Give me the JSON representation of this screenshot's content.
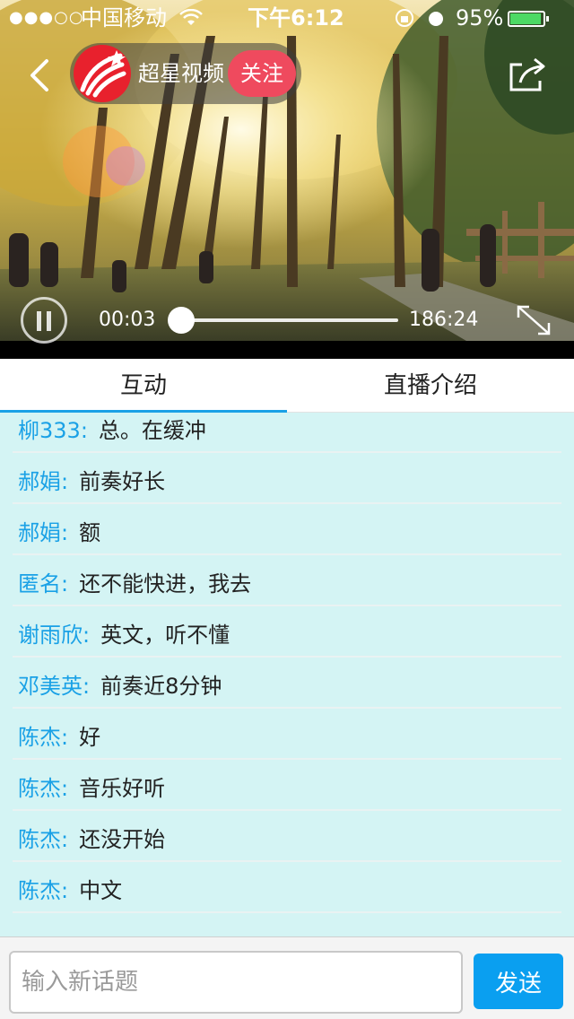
{
  "status_bar": {
    "signal": "●●●○○",
    "carrier": "中国移动",
    "wifi_icon": "wifi-icon",
    "time": "下午6:12",
    "battery_percent": "95%",
    "battery_level": 0.95
  },
  "player": {
    "channel_name": "超星视频",
    "follow_label": "关注",
    "time_current": "00:03",
    "time_total": "186:24",
    "progress": 0.0003,
    "icons": {
      "back": "back-icon",
      "share": "share-icon",
      "pause": "pause-icon",
      "fullscreen": "fullscreen-icon",
      "logo": "chaoxing-logo-icon"
    }
  },
  "tabs": [
    {
      "label": "互动",
      "active": true
    },
    {
      "label": "直播介绍",
      "active": false
    }
  ],
  "messages": [
    {
      "name": "柳333",
      "text": "总。在缓冲"
    },
    {
      "name": "郝娟",
      "text": "前奏好长"
    },
    {
      "name": "郝娟",
      "text": "额"
    },
    {
      "name": "匿名",
      "text": "还不能快进，我去"
    },
    {
      "name": "谢雨欣",
      "text": "英文，听不懂"
    },
    {
      "name": "邓美英",
      "text": "前奏近8分钟"
    },
    {
      "name": "陈杰",
      "text": "好"
    },
    {
      "name": "陈杰",
      "text": "音乐好听"
    },
    {
      "name": "陈杰",
      "text": "还没开始"
    },
    {
      "name": "陈杰",
      "text": "中文"
    }
  ],
  "composer": {
    "placeholder": "输入新话题",
    "value": "",
    "send_label": "发送"
  },
  "colors": {
    "accent": "#1aa1e6",
    "follow": "#ef4a5e",
    "send": "#0a9ff0",
    "chat_bg": "#d4f4f4"
  }
}
